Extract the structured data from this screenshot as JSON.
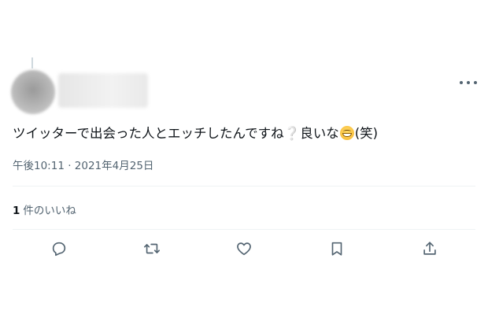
{
  "tweet": {
    "text_main": "ツイッターで出会った人とエッチしたんですね",
    "text_q": "❔",
    "text_mid": "良いな",
    "text_end": "(笑)",
    "emoji": "grinning-face",
    "timestamp": "午後10:11 · 2021年4月25日"
  },
  "likes": {
    "count": "1",
    "label": "件のいいね"
  },
  "colors": {
    "text": "#0f1419",
    "secondary": "#536471",
    "divider": "#eff3f4"
  },
  "icons": [
    "more-icon",
    "reply-icon",
    "retweet-icon",
    "like-icon",
    "bookmark-icon",
    "share-icon"
  ]
}
